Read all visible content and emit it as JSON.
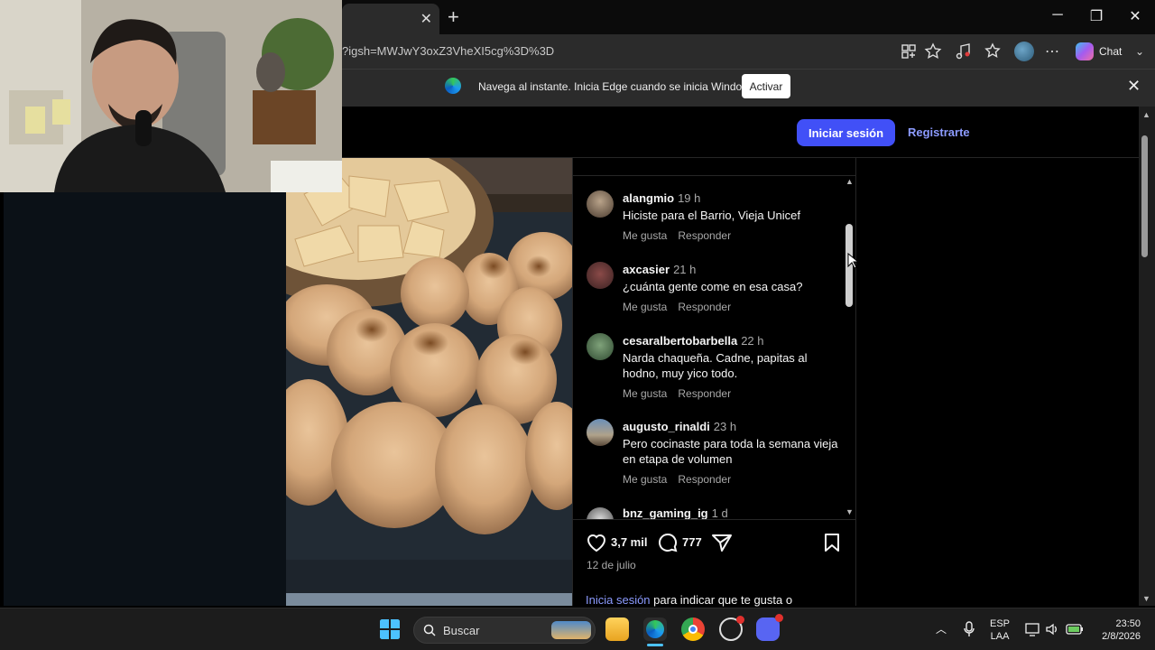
{
  "browser": {
    "url_fragment": "?igsh=MWJwY3oxZ3VheXI5cg%3D%3D",
    "chat_label": "Chat",
    "infobar_text": "Navega al instante. Inicia Edge cuando se inicia Windows.",
    "activate_label": "Activar"
  },
  "header": {
    "login_label": "Iniciar sesión",
    "signup_label": "Registrarte"
  },
  "comments": [
    {
      "user": "alangmio",
      "time": "19 h",
      "text": "Hiciste para el Barrio, Vieja Unicef",
      "like": "Me gusta",
      "reply": "Responder"
    },
    {
      "user": "axcasier",
      "time": "21 h",
      "text": "¿cuánta gente come en esa casa?",
      "like": "Me gusta",
      "reply": "Responder"
    },
    {
      "user": "cesaralbertobarbella",
      "time": "22 h",
      "text": "Narda chaqueña. Cadne, papitas al hodno, muy yico todo.",
      "like": "Me gusta",
      "reply": "Responder"
    },
    {
      "user": "augusto_rinaldi",
      "time": "23 h",
      "text": "Pero cocinaste para toda la semana vieja en etapa de volumen",
      "like": "Me gusta",
      "reply": "Responder"
    },
    {
      "user": "bnz_gaming_ig",
      "time": "1 d",
      "text": "",
      "like": "",
      "reply": ""
    }
  ],
  "post": {
    "likes": "3,7 mil",
    "comment_count": "777",
    "date": "12 de julio",
    "login_link": "Inicia sesión",
    "login_suffix": " para indicar que te gusta o"
  },
  "taskbar": {
    "search_label": "Buscar",
    "lang_top": "ESP",
    "lang_bottom": "LAA",
    "time": "23:50",
    "date": "2/8/2026"
  },
  "colors": {
    "accent_button": "#4150f7",
    "link": "#8c9bff"
  }
}
